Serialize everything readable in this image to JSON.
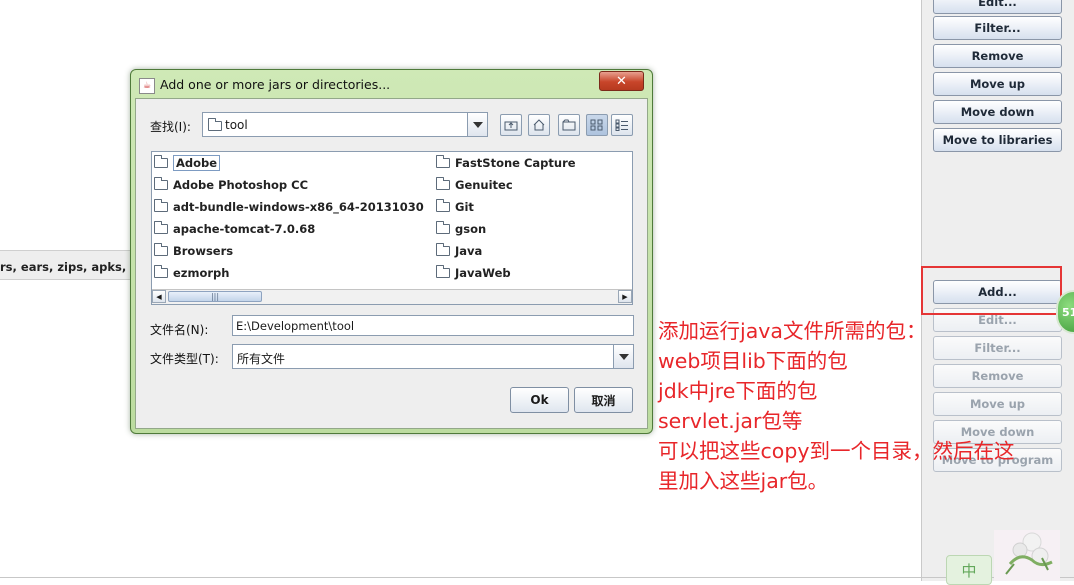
{
  "background": {
    "top_buttons": [
      "Edit...",
      "Filter...",
      "Remove",
      "Move up",
      "Move down",
      "Move to libraries"
    ],
    "bottom_buttons": [
      "Add...",
      "Edit...",
      "Filter...",
      "Remove",
      "Move up",
      "Move down",
      "Move to program"
    ],
    "left_strip_text": "rs, ears, zips, apks, and",
    "badge_text": "51",
    "ime_label": "中"
  },
  "dialog": {
    "title": "Add one or more jars or directories...",
    "close_label": "✕",
    "look_in_label": "查找(I):",
    "look_in_value": "tool",
    "toolbar_icons": [
      "up-folder-icon",
      "home-icon",
      "new-folder-icon",
      "list-view-icon",
      "details-view-icon"
    ],
    "files_left": [
      "Adobe",
      "Adobe Photoshop CC",
      "adt-bundle-windows-x86_64-20131030",
      "apache-tomcat-7.0.68",
      "Browsers",
      "ezmorph"
    ],
    "files_right": [
      "FastStone Capture",
      "Genuitec",
      "Git",
      "gson",
      "Java",
      "JavaWeb"
    ],
    "selected_file": "Adobe",
    "filename_label": "文件名(N):",
    "filename_value": "E:\\Development\\tool",
    "filetype_label": "文件类型(T):",
    "filetype_value": "所有文件",
    "ok_label": "Ok",
    "cancel_label": "取消"
  },
  "annotation": {
    "lines": [
      "添加运行java文件所需的包：",
      "web项目lib下面的包",
      "jdk中jre下面的包",
      "servlet.jar包等",
      "可以把这些copy到一个目录，然后在这",
      "里加入这些jar包。"
    ],
    "color": "#e8262a"
  }
}
